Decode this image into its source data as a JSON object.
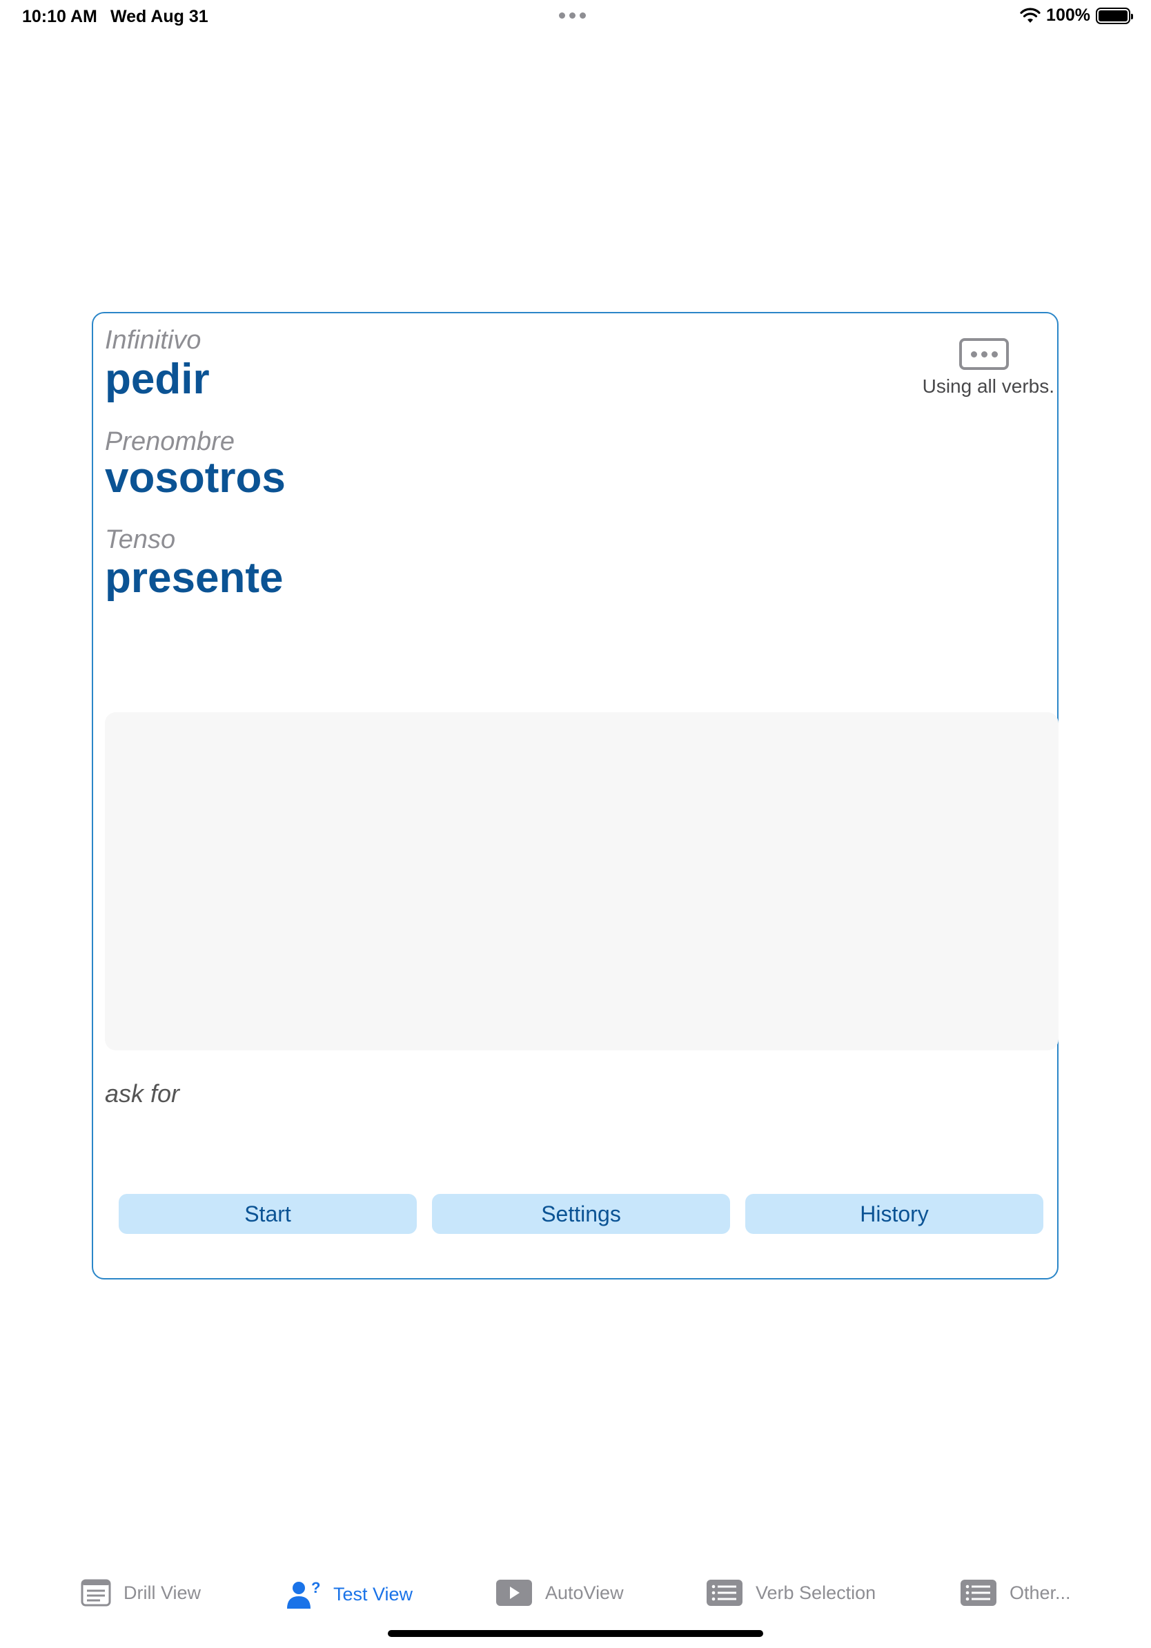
{
  "status_bar": {
    "time": "10:10 AM",
    "date": "Wed Aug 31",
    "battery": "100%"
  },
  "card": {
    "infinitive_label": "Infinitivo",
    "infinitive_value": "pedir",
    "pronoun_label": "Prenombre",
    "pronoun_value": "vosotros",
    "tense_label": "Tenso",
    "tense_value": "presente",
    "verbs_note": "Using all verbs.",
    "answer_text": "",
    "translation": "ask for",
    "buttons": {
      "start": "Start",
      "settings": "Settings",
      "history": "History"
    }
  },
  "tabs": [
    {
      "label": "Drill View",
      "icon": "list-document-icon",
      "active": false
    },
    {
      "label": "Test View",
      "icon": "person-question-icon",
      "active": true
    },
    {
      "label": "AutoView",
      "icon": "play-icon",
      "active": false
    },
    {
      "label": "Verb Selection",
      "icon": "list-icon",
      "active": false
    },
    {
      "label": "Other...",
      "icon": "list-icon",
      "active": false
    }
  ],
  "colors": {
    "accent": "#0b5394",
    "card_border": "#2b86c8",
    "button_bg": "#c8e6fb",
    "active_tab": "#1a73e8",
    "inactive_tab": "#8e8e93"
  }
}
